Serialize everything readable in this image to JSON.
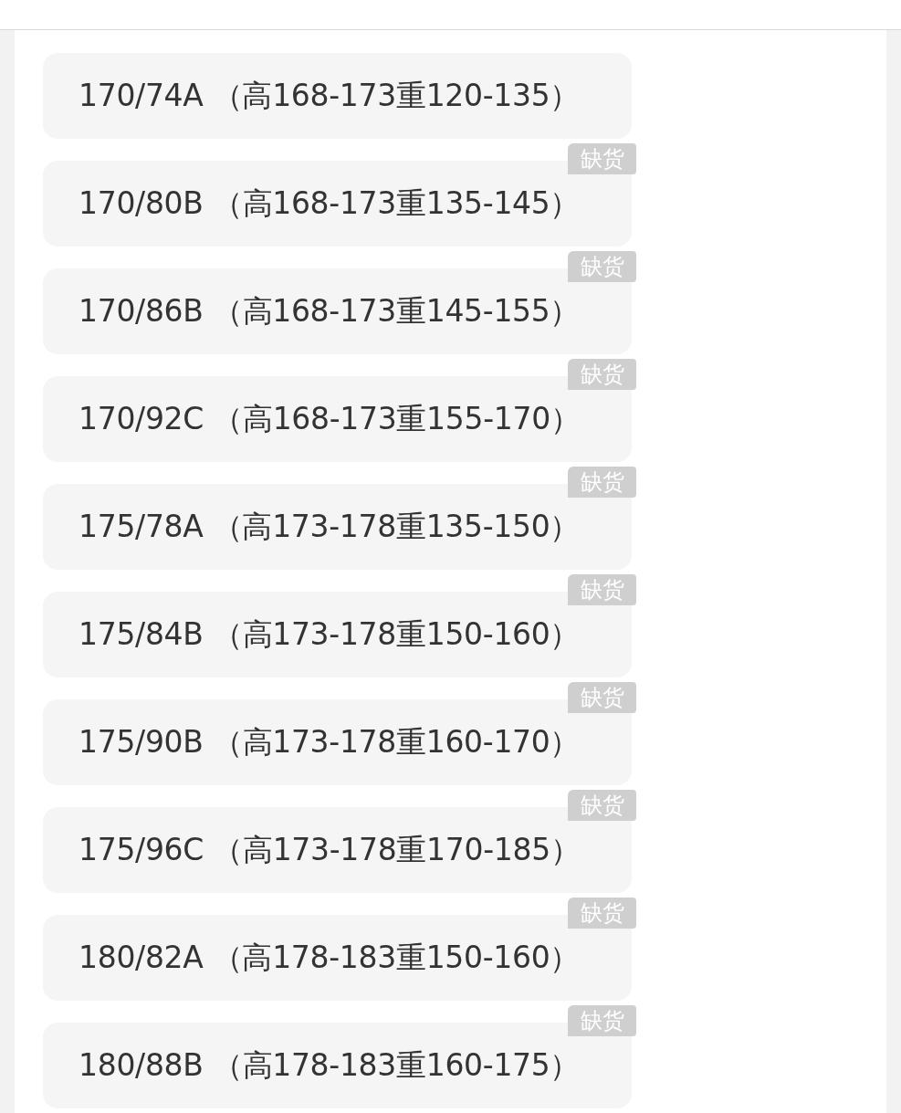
{
  "options": [
    {
      "label": "170/74A （高168-173重120-135）"
    },
    {
      "label": "170/80B （高168-173重135-145）",
      "badge": "缺货"
    },
    {
      "label": "170/86B （高168-173重145-155）",
      "badge": "缺货"
    },
    {
      "label": "170/92C （高168-173重155-170）",
      "badge": "缺货"
    },
    {
      "label": "175/78A （高173-178重135-150）",
      "badge": "缺货"
    },
    {
      "label": "175/84B （高173-178重150-160）",
      "badge": "缺货"
    },
    {
      "label": "175/90B （高173-178重160-170）",
      "badge": "缺货"
    },
    {
      "label": "175/96C （高173-178重170-185）",
      "badge": "缺货"
    },
    {
      "label": "180/82A （高178-183重150-160）",
      "badge": "缺货"
    },
    {
      "label": "180/88B （高178-183重160-175）",
      "badge": "缺货"
    }
  ]
}
